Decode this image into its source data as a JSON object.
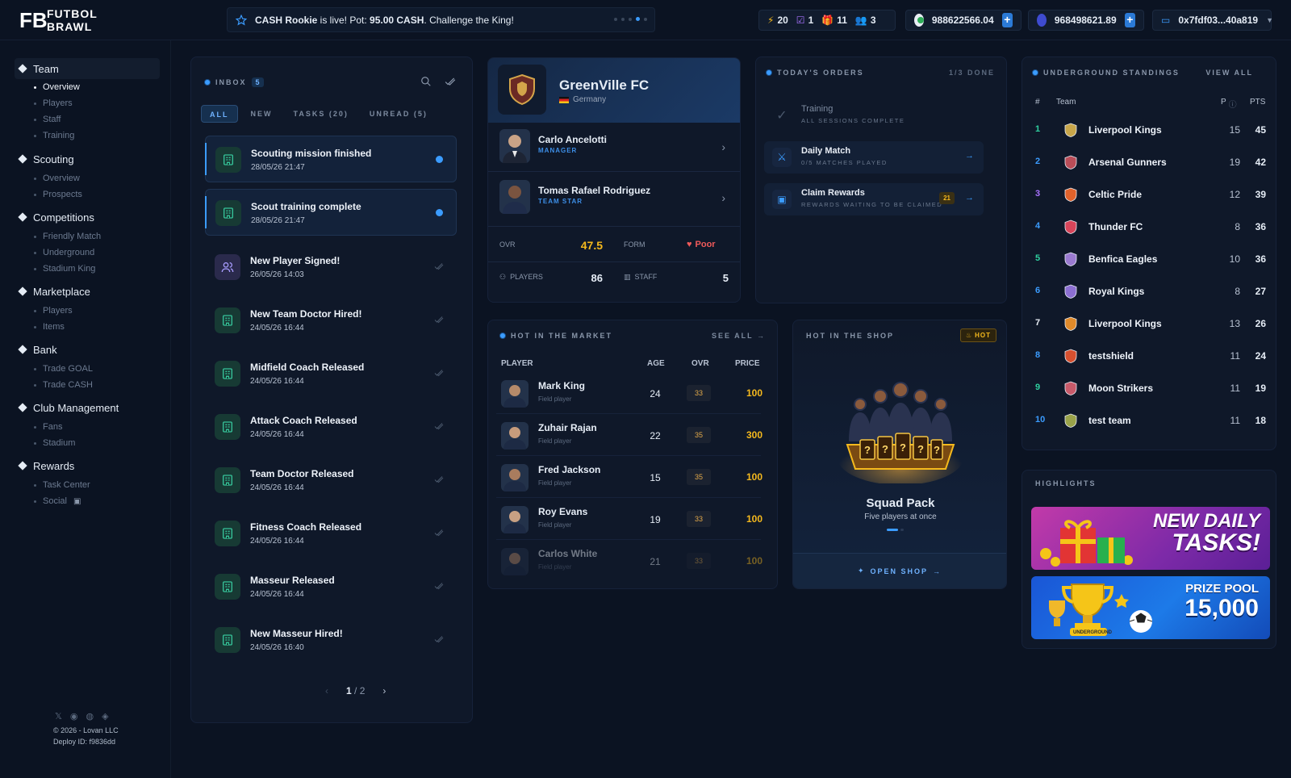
{
  "brand": {
    "logo_mark": "FB",
    "logo_line1": "FUTBOL",
    "logo_line2": "BRAWL"
  },
  "ticker": {
    "prefix": "CASH Rookie",
    "middle": " is live! Pot: ",
    "pot": "95.00 CASH",
    "suffix": ". Challenge the King!",
    "slides": 5,
    "active_slide": 4
  },
  "stats": {
    "energy": "20",
    "tasks": "1",
    "gifts": "11",
    "friends": "3"
  },
  "wallets": {
    "goal_balance": "988622566.04",
    "cash_balance": "968498621.89",
    "address": "0x7fdf03...40a819"
  },
  "sidebar": {
    "groups": [
      {
        "label": "Team",
        "items": [
          "Overview",
          "Players",
          "Staff",
          "Training"
        ]
      },
      {
        "label": "Scouting",
        "items": [
          "Overview",
          "Prospects"
        ]
      },
      {
        "label": "Competitions",
        "items": [
          "Friendly Match",
          "Underground",
          "Stadium King"
        ]
      },
      {
        "label": "Marketplace",
        "items": [
          "Players",
          "Items"
        ]
      },
      {
        "label": "Bank",
        "items": [
          "Trade GOAL",
          "Trade CASH"
        ]
      },
      {
        "label": "Club Management",
        "items": [
          "Fans",
          "Stadium"
        ]
      },
      {
        "label": "Rewards",
        "items": [
          "Task Center",
          "Social"
        ]
      }
    ],
    "copyright": "© 2026 - Lovan LLC",
    "deploy": "Deploy ID: f9836dd"
  },
  "inbox": {
    "title": "INBOX",
    "count": "5",
    "tabs": [
      "ALL",
      "NEW",
      "TASKS (20)",
      "UNREAD (5)"
    ],
    "messages": [
      {
        "title": "Scouting mission finished",
        "date": "28/05/26 21:47"
      },
      {
        "title": "Scout training complete",
        "date": "28/05/26 21:47"
      },
      {
        "title": "New Player Signed!",
        "date": "26/05/26 14:03"
      },
      {
        "title": "New Team Doctor Hired!",
        "date": "24/05/26 16:44"
      },
      {
        "title": "Midfield Coach Released",
        "date": "24/05/26 16:44"
      },
      {
        "title": "Attack Coach Released",
        "date": "24/05/26 16:44"
      },
      {
        "title": "Team Doctor Released",
        "date": "24/05/26 16:44"
      },
      {
        "title": "Fitness Coach Released",
        "date": "24/05/26 16:44"
      },
      {
        "title": "Masseur Released",
        "date": "24/05/26 16:44"
      },
      {
        "title": "New Masseur Hired!",
        "date": "24/05/26 16:40"
      }
    ],
    "page": "1",
    "pages": "2"
  },
  "club": {
    "name": "GreenVille FC",
    "country": "Germany",
    "manager_name": "Carlo Ancelotti",
    "manager_role": "MANAGER",
    "star_name": "Tomas Rafael Rodriguez",
    "star_role": "TEAM STAR",
    "ovr_label": "OVR",
    "ovr": "47.5",
    "form_label": "FORM",
    "form": "Poor",
    "players_label": "PLAYERS",
    "players": "86",
    "staff_label": "STAFF",
    "staff": "5"
  },
  "orders": {
    "title": "TODAY'S ORDERS",
    "progress": "1/3 DONE",
    "items": [
      {
        "title": "Training",
        "sub": "ALL SESSIONS COMPLETE"
      },
      {
        "title": "Daily Match",
        "sub": "0/5 MATCHES PLAYED"
      },
      {
        "title": "Claim Rewards",
        "sub": "REWARDS WAITING TO BE CLAIMED",
        "badge": "21"
      }
    ]
  },
  "market": {
    "title": "HOT IN THE MARKET",
    "see_all": "SEE ALL",
    "columns": [
      "PLAYER",
      "AGE",
      "OVR",
      "PRICE"
    ],
    "rows": [
      {
        "name": "Mark King",
        "type": "Field player",
        "age": "24",
        "ovr": "33",
        "price": "100"
      },
      {
        "name": "Zuhair Rajan",
        "type": "Field player",
        "age": "22",
        "ovr": "35",
        "price": "300"
      },
      {
        "name": "Fred Jackson",
        "type": "Field player",
        "age": "15",
        "ovr": "35",
        "price": "100"
      },
      {
        "name": "Roy Evans",
        "type": "Field player",
        "age": "19",
        "ovr": "33",
        "price": "100"
      },
      {
        "name": "Carlos White",
        "type": "Field player",
        "age": "21",
        "ovr": "33",
        "price": "100"
      }
    ]
  },
  "shop": {
    "title": "HOT IN THE SHOP",
    "badge": "HOT",
    "pack_name": "Squad Pack",
    "pack_desc": "Five players at once",
    "open": "OPEN SHOP"
  },
  "standings": {
    "title": "UNDERGROUND STANDINGS",
    "view_all": "VIEW ALL",
    "columns": [
      "#",
      "Team",
      "P",
      "PTS"
    ],
    "rows": [
      {
        "rank": "1",
        "team": "Liverpool Kings",
        "p": "15",
        "pts": "45",
        "crest": "#c8a64a"
      },
      {
        "rank": "2",
        "team": "Arsenal Gunners",
        "p": "19",
        "pts": "42",
        "crest": "#b94d58"
      },
      {
        "rank": "3",
        "team": "Celtic Pride",
        "p": "12",
        "pts": "39",
        "crest": "#e0622b"
      },
      {
        "rank": "4",
        "team": "Thunder FC",
        "p": "8",
        "pts": "36",
        "crest": "#d8455a"
      },
      {
        "rank": "5",
        "team": "Benfica Eagles",
        "p": "10",
        "pts": "36",
        "crest": "#9a7ad0"
      },
      {
        "rank": "6",
        "team": "Royal Kings",
        "p": "8",
        "pts": "27",
        "crest": "#8c6fd2"
      },
      {
        "rank": "7",
        "team": "Liverpool Kings",
        "p": "13",
        "pts": "26",
        "crest": "#e08a2a"
      },
      {
        "rank": "8",
        "team": "testshield",
        "p": "11",
        "pts": "24",
        "crest": "#d6502f"
      },
      {
        "rank": "9",
        "team": "Moon Strikers",
        "p": "11",
        "pts": "19",
        "crest": "#c85a6a"
      },
      {
        "rank": "10",
        "team": "test team",
        "p": "11",
        "pts": "18",
        "crest": "#9aa34a"
      }
    ],
    "rank_colors": [
      "#2fd0a0",
      "#3b9cff",
      "#a872ff",
      "#3b9cff",
      "#2fd0a0",
      "#3b9cff",
      "#e8edf5",
      "#3b9cff",
      "#2fd0a0",
      "#3b9cff"
    ]
  },
  "highlights": {
    "title": "HIGHLIGHTS",
    "banner1_line1": "NEW DAILY",
    "banner1_line2": "TASKS!",
    "banner2_line1": "PRIZE POOL",
    "banner2_value": "15,000",
    "banner2_tag": "UNDERGROUND"
  },
  "colors": {
    "accent": "#3b9cff",
    "gold": "#f5b91d",
    "bg": "#0b1322",
    "panel": "#0f1829"
  }
}
